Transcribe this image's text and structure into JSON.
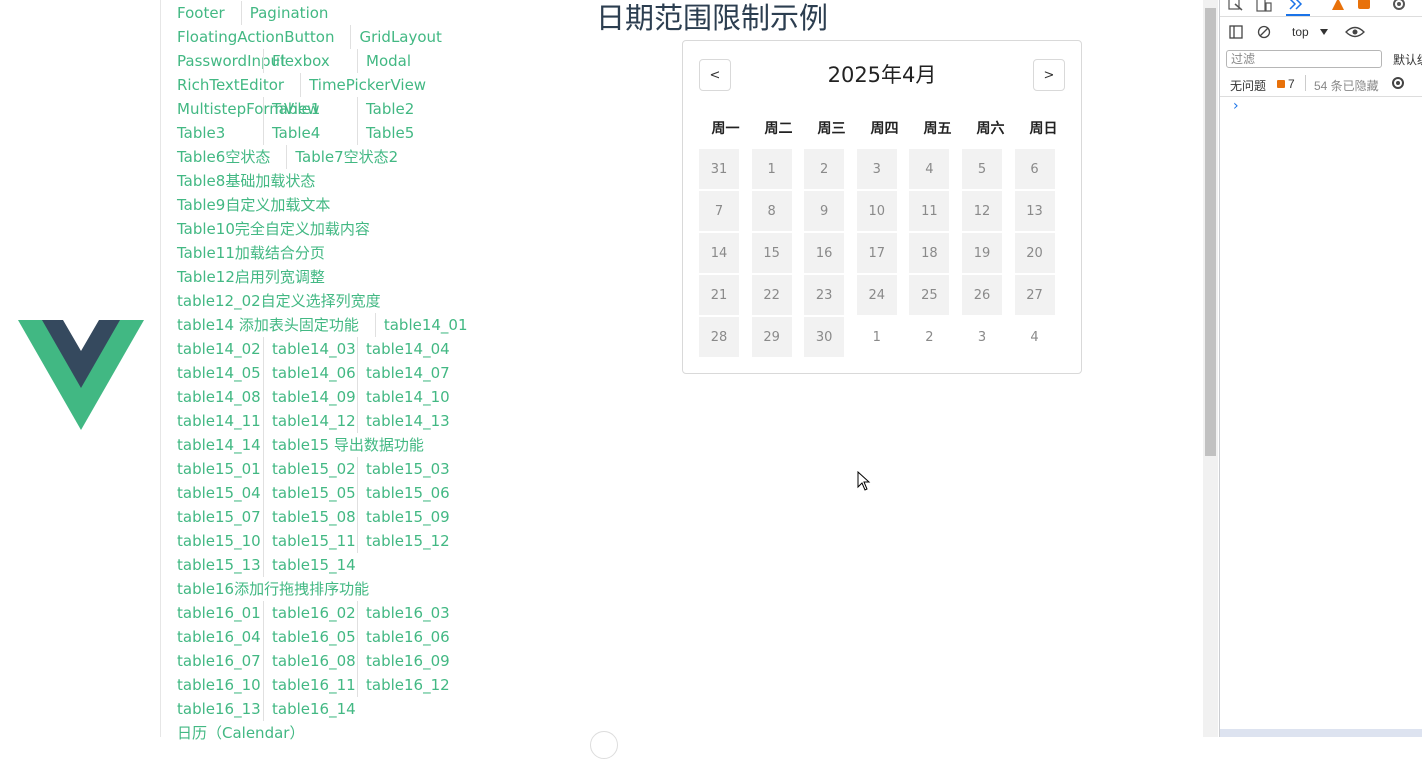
{
  "nav": {
    "rows": [
      [
        "Footer",
        "Pagination"
      ],
      [
        "FloatingActionButton",
        "GridLayout"
      ],
      [
        "PasswordInput",
        "Flexbox",
        "Modal"
      ],
      [
        "RichTextEditor",
        "TimePickerView"
      ],
      [
        "MultistepFormView",
        "Table1",
        "Table2"
      ],
      [
        "Table3",
        "Table4",
        "Table5"
      ],
      [
        "Table6空状态",
        "Table7空状态2"
      ],
      [
        "Table8基础加载状态"
      ],
      [
        "Table9自定义加载文本"
      ],
      [
        "Table10完全自定义加载内容"
      ],
      [
        "Table11加载结合分页"
      ],
      [
        "Table12启用列宽调整"
      ],
      [
        "table12_02自定义选择列宽度"
      ],
      [
        "table14 添加表头固定功能",
        "table14_01"
      ],
      [
        "table14_02",
        "table14_03",
        "table14_04"
      ],
      [
        "table14_05",
        "table14_06",
        "table14_07"
      ],
      [
        "table14_08",
        "table14_09",
        "table14_10"
      ],
      [
        "table14_11",
        "table14_12",
        "table14_13"
      ],
      [
        "table14_14",
        "table15 导出数据功能"
      ],
      [
        "table15_01",
        "table15_02",
        "table15_03"
      ],
      [
        "table15_04",
        "table15_05",
        "table15_06"
      ],
      [
        "table15_07",
        "table15_08",
        "table15_09"
      ],
      [
        "table15_10",
        "table15_11",
        "table15_12"
      ],
      [
        "table15_13",
        "table15_14"
      ],
      [
        "table16添加行拖拽排序功能"
      ],
      [
        "table16_01",
        "table16_02",
        "table16_03"
      ],
      [
        "table16_04",
        "table16_05",
        "table16_06"
      ],
      [
        "table16_07",
        "table16_08",
        "table16_09"
      ],
      [
        "table16_10",
        "table16_11",
        "table16_12"
      ],
      [
        "table16_13",
        "table16_14"
      ],
      [
        "日历（Calendar）"
      ]
    ]
  },
  "page": {
    "title": "日期范围限制示例"
  },
  "calendar": {
    "month_label": "2025年4月",
    "prev_label": "<",
    "next_label": ">",
    "weekdays": [
      "周一",
      "周二",
      "周三",
      "周四",
      "周五",
      "周六",
      "周日"
    ],
    "weeks": [
      [
        {
          "d": "31",
          "in": true
        },
        {
          "d": "1",
          "in": true
        },
        {
          "d": "2",
          "in": true
        },
        {
          "d": "3",
          "in": true
        },
        {
          "d": "4",
          "in": true
        },
        {
          "d": "5",
          "in": true
        },
        {
          "d": "6",
          "in": true
        }
      ],
      [
        {
          "d": "7",
          "in": true
        },
        {
          "d": "8",
          "in": true
        },
        {
          "d": "9",
          "in": true
        },
        {
          "d": "10",
          "in": true
        },
        {
          "d": "11",
          "in": true
        },
        {
          "d": "12",
          "in": true
        },
        {
          "d": "13",
          "in": true
        }
      ],
      [
        {
          "d": "14",
          "in": true
        },
        {
          "d": "15",
          "in": true
        },
        {
          "d": "16",
          "in": true
        },
        {
          "d": "17",
          "in": true
        },
        {
          "d": "18",
          "in": true
        },
        {
          "d": "19",
          "in": true
        },
        {
          "d": "20",
          "in": true
        }
      ],
      [
        {
          "d": "21",
          "in": true
        },
        {
          "d": "22",
          "in": true
        },
        {
          "d": "23",
          "in": true
        },
        {
          "d": "24",
          "in": true
        },
        {
          "d": "25",
          "in": true
        },
        {
          "d": "26",
          "in": true
        },
        {
          "d": "27",
          "in": true
        }
      ],
      [
        {
          "d": "28",
          "in": true
        },
        {
          "d": "29",
          "in": true
        },
        {
          "d": "30",
          "in": true
        },
        {
          "d": "1",
          "in": false
        },
        {
          "d": "2",
          "in": false
        },
        {
          "d": "3",
          "in": false
        },
        {
          "d": "4",
          "in": false
        }
      ]
    ]
  },
  "devtools": {
    "context": "top",
    "filter_placeholder": "过滤",
    "default_levels": "默认级",
    "no_issues": "无问题",
    "issues_count": "7",
    "hidden_count": "54 条已隐藏",
    "expand_arrow": "›"
  },
  "colors": {
    "link": "#42b883",
    "text": "#2c3e50"
  }
}
